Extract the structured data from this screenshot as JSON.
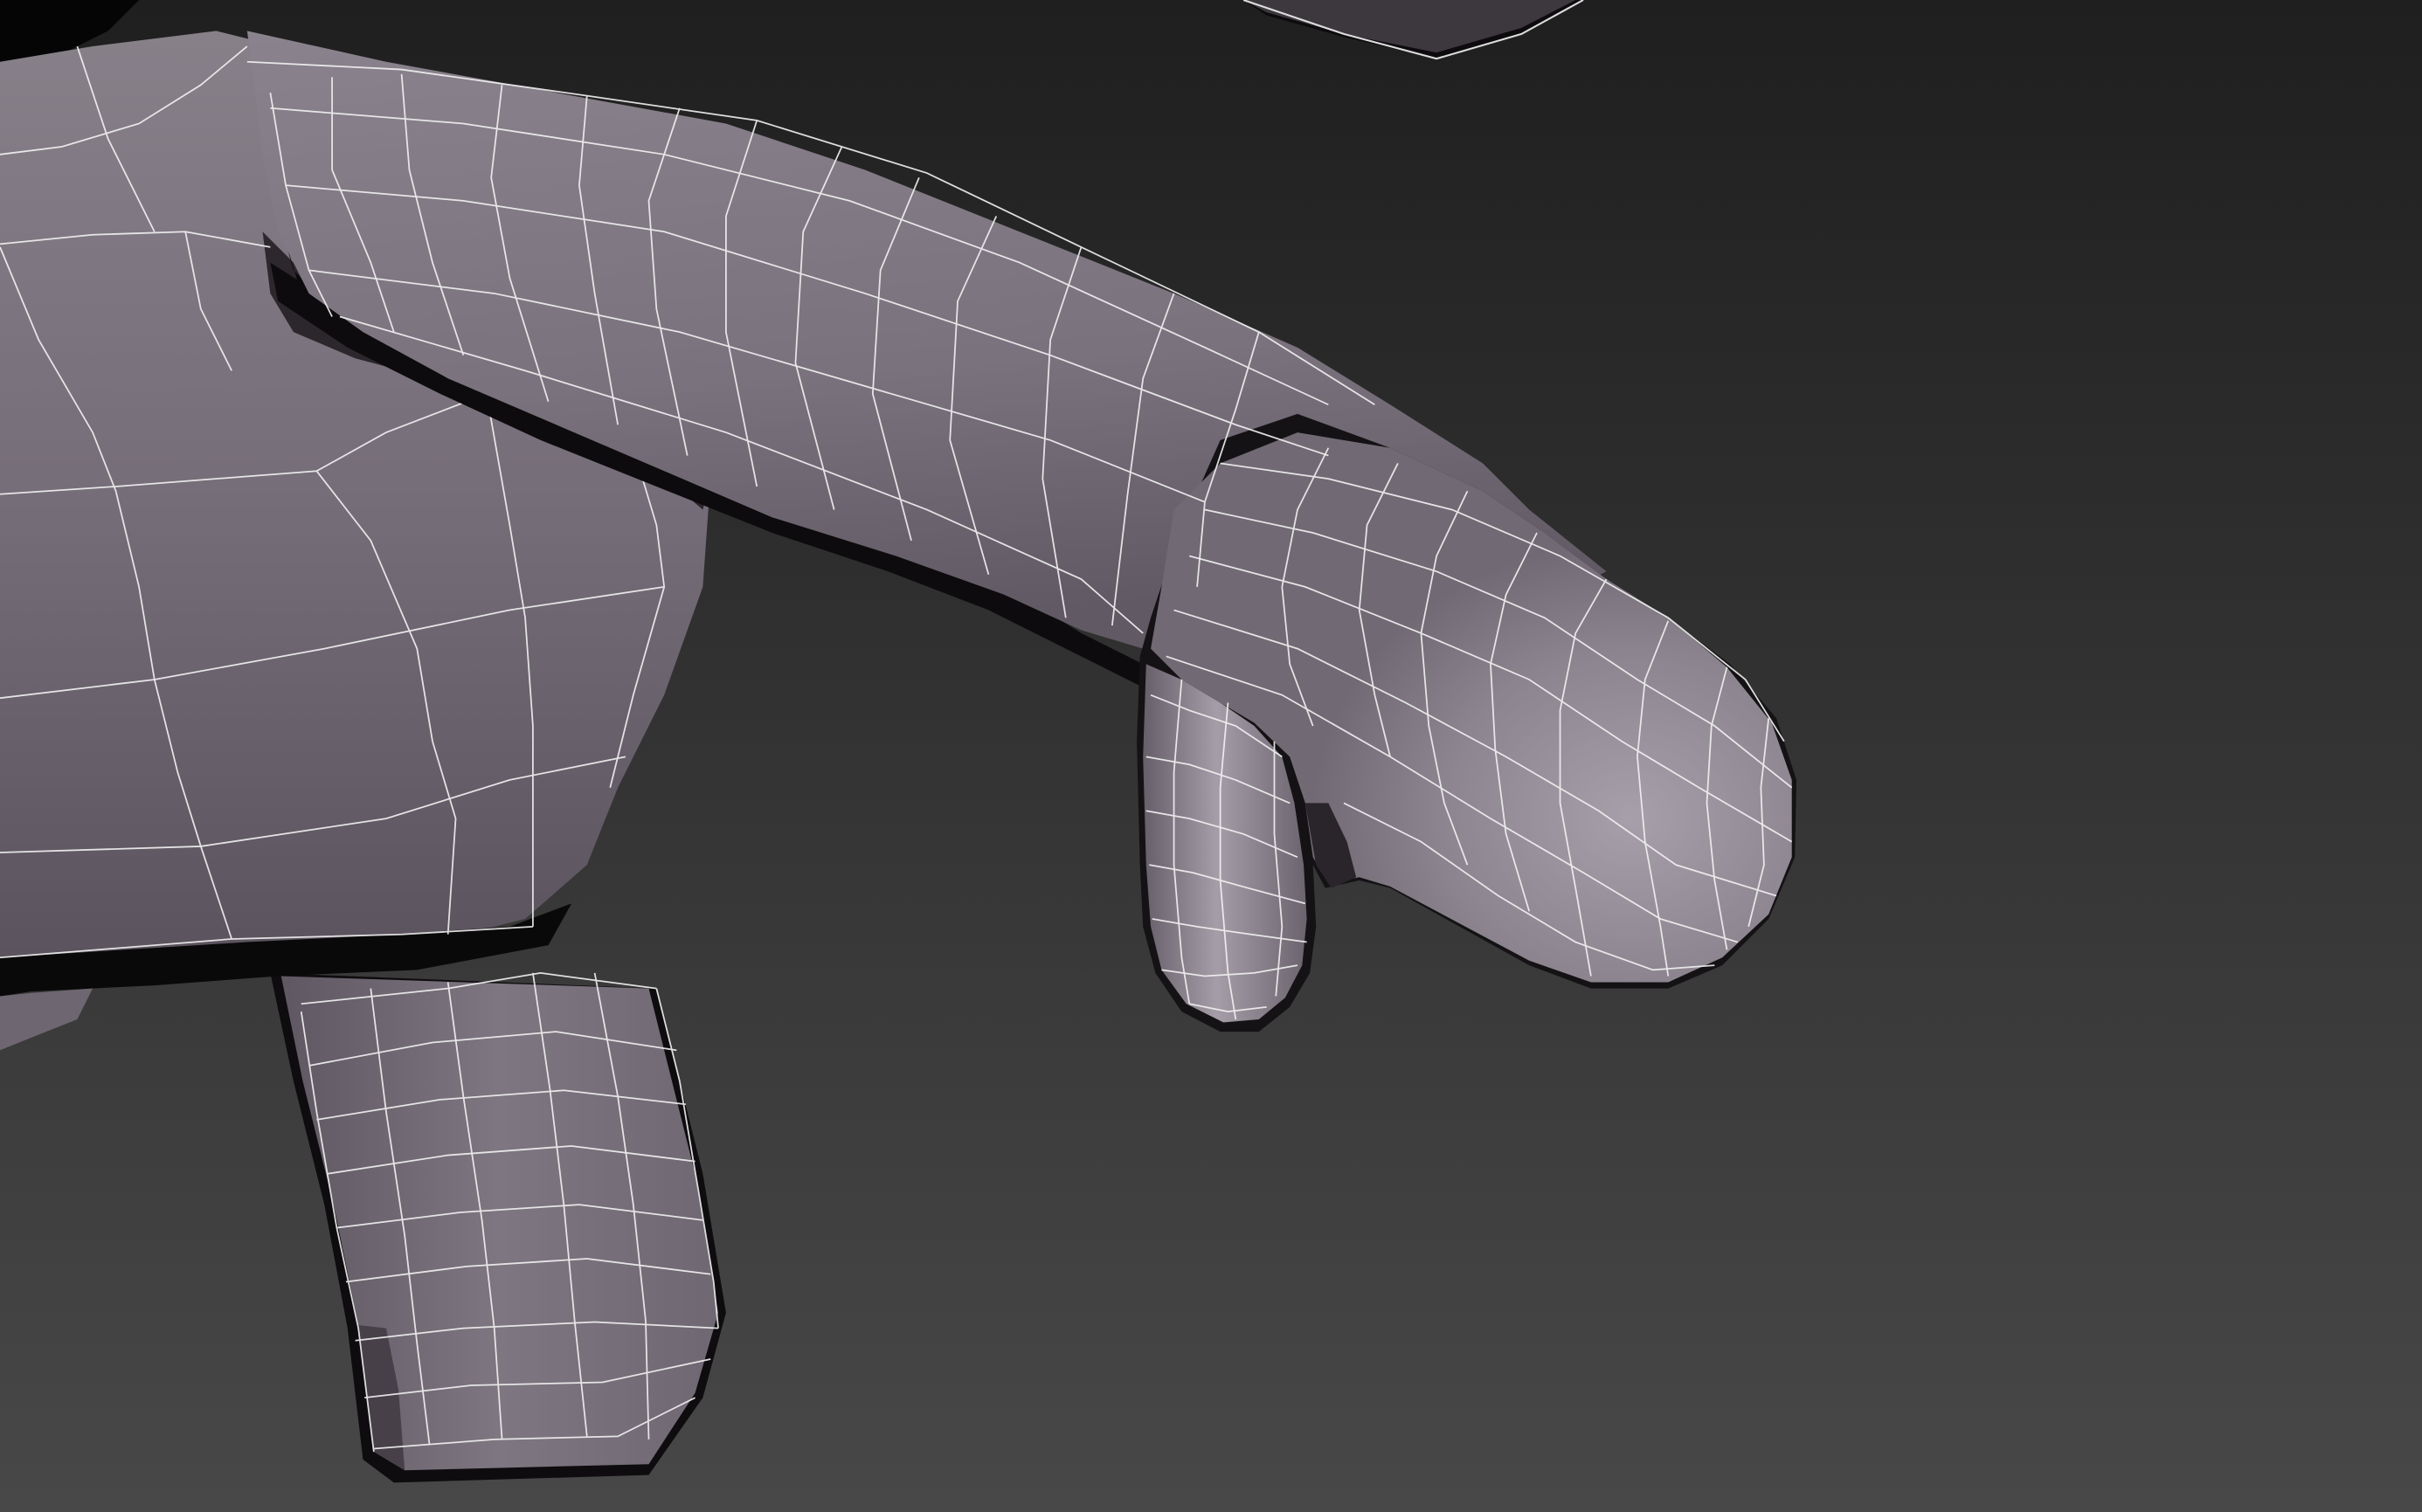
{
  "viewport": {
    "background_top": "#1f1f1f",
    "background_bottom": "#484848",
    "mesh_color": "#7e7480",
    "mesh_highlight": "#a9a1ab",
    "mesh_shadow": "#3c353e",
    "wire_color": "#f2f2f2",
    "wire_hidden_color": "#5b5b5b"
  }
}
